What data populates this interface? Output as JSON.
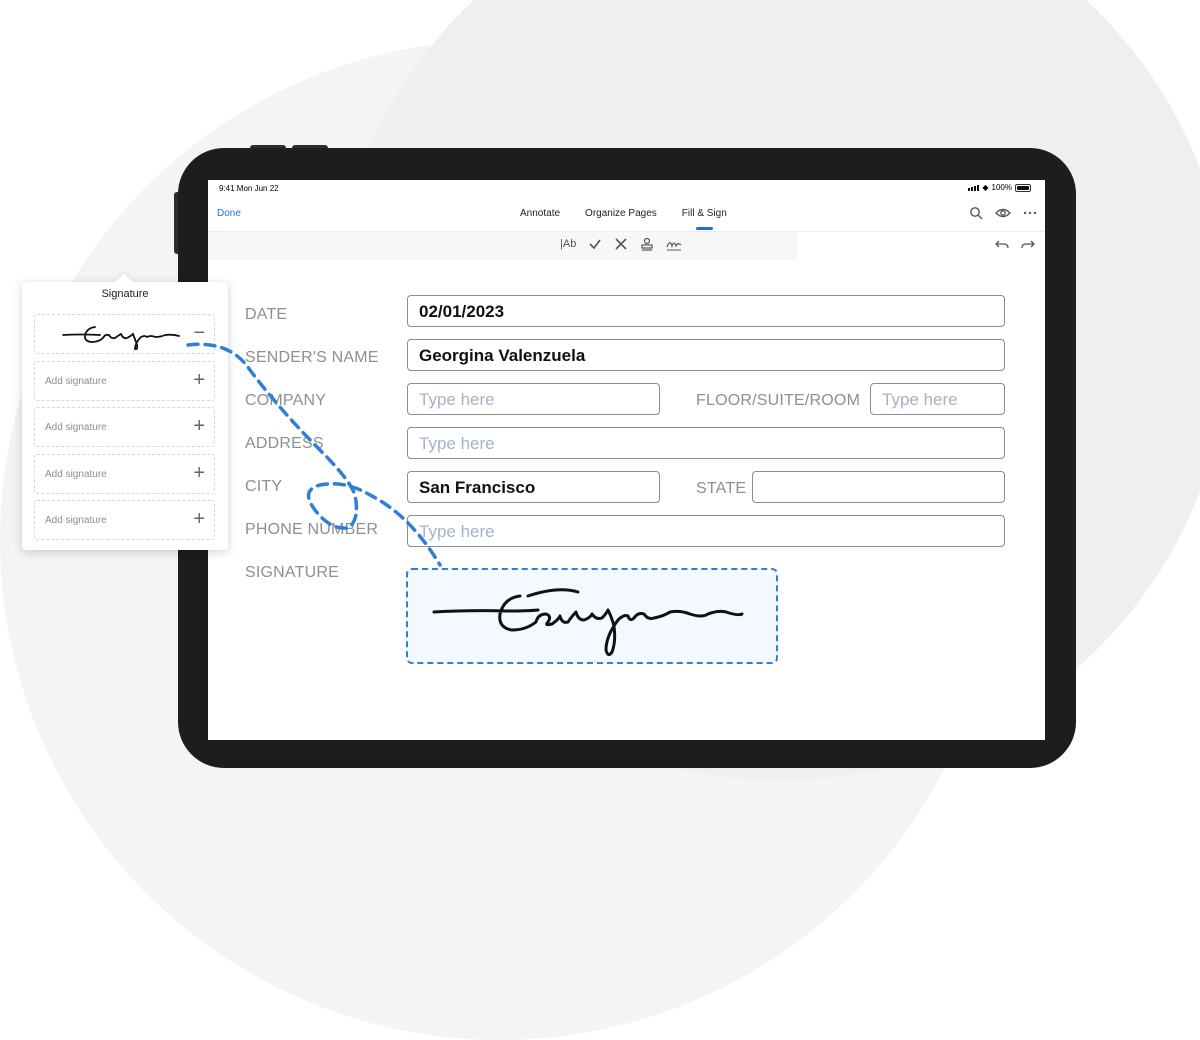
{
  "status_bar": {
    "time": "9:41 Mon Jun 22",
    "battery": "100%"
  },
  "toolbar": {
    "done_label": "Done",
    "tabs": [
      {
        "label": "Annotate",
        "active": false
      },
      {
        "label": "Organize Pages",
        "active": false
      },
      {
        "label": "Fill & Sign",
        "active": true
      }
    ],
    "icons": [
      "search-icon",
      "eye-icon",
      "more-icon"
    ],
    "tools": [
      "text-tool-icon",
      "checkmark-icon",
      "cross-icon",
      "stamp-icon",
      "signature-icon"
    ],
    "tools_text": "|Ab",
    "accent_color": "#1e6fd9"
  },
  "form": {
    "date": {
      "label": "DATE",
      "value": "02/01/2023"
    },
    "sender_name": {
      "label": "SENDER'S NAME",
      "value": "Georgina Valenzuela"
    },
    "company": {
      "label": "COMPANY",
      "placeholder": "Type here"
    },
    "floor": {
      "label": "FLOOR/SUITE/ROOM",
      "placeholder": "Type here"
    },
    "address": {
      "label": "ADDRESS",
      "placeholder": "Type here"
    },
    "city": {
      "label": "CITY",
      "value": "San Francisco"
    },
    "state": {
      "label": "STATE",
      "value": ""
    },
    "phone": {
      "label": "PHONE NUMBER",
      "placeholder": "Type here"
    },
    "signature": {
      "label": "SIGNATURE"
    }
  },
  "signature_panel": {
    "title": "Signature",
    "slots": [
      {
        "label": "Add signature"
      },
      {
        "label": "Add signature"
      },
      {
        "label": "Add signature"
      },
      {
        "label": "Add signature"
      }
    ]
  },
  "colors": {
    "dash_line": "#2f7fd6",
    "label_gray": "#8c8f93",
    "placeholder": "#a4b3c4"
  }
}
